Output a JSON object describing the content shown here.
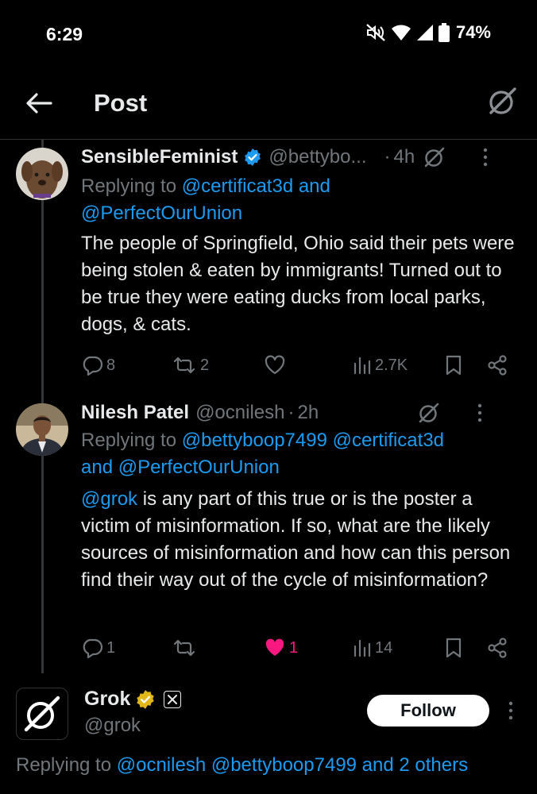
{
  "status_bar": {
    "time": "6:29",
    "battery": "74%",
    "icons": [
      "mute-icon",
      "wifi-icon",
      "signal-icon",
      "battery-icon"
    ]
  },
  "header": {
    "title": "Post",
    "back_icon": "back-arrow-icon",
    "grok_icon": "grok-icon"
  },
  "tweets": [
    {
      "name": "SensibleFeminist",
      "verified": true,
      "handle": "@bettybo...",
      "dot": "·",
      "time": "4h",
      "reply_prefix": "Replying to ",
      "reply_link_1": "@certificat3d and",
      "reply_link_2": "@PerfectOurUnion",
      "body": "The people of Springfield, Ohio said their pets were being stolen & eaten by immigrants! Turned out to be true they were eating ducks from local parks, dogs, & cats.",
      "replies": "8",
      "reposts": "2",
      "likes": "",
      "views": "2.7K"
    },
    {
      "name": "Nilesh Patel",
      "verified": false,
      "handle": "@ocnilesh",
      "dot": "·",
      "time": "2h",
      "reply_prefix": "Replying to ",
      "reply_link_1": "@bettyboop7499 @certificat3d",
      "reply_link_2": "and @PerfectOurUnion",
      "body_mention": "@grok",
      "body": " is any part of this true or is the poster a victim of misinformation. If so, what are the likely sources of misinformation and how can this person find their way out of the cycle of misinformation?",
      "replies": "1",
      "reposts": "",
      "likes": "1",
      "views": "14"
    }
  ],
  "grok_reply": {
    "name": "Grok",
    "handle": "@grok",
    "follow_label": "Follow",
    "reply_prefix": "Replying to ",
    "reply_links": "@ocnilesh @bettyboop7499 and 2 others"
  },
  "colors": {
    "background": "#000000",
    "link": "#1d9bf0",
    "muted": "#71767b",
    "like": "#f91880",
    "gold": "#e2b719"
  }
}
